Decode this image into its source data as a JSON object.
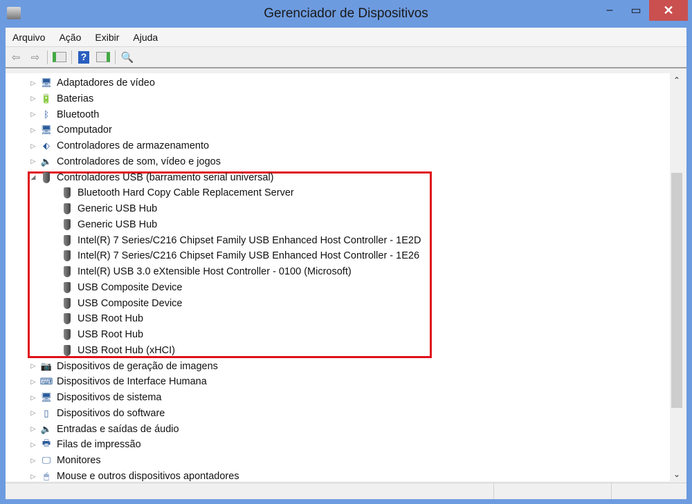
{
  "window": {
    "title": "Gerenciador de Dispositivos",
    "minimize": "–",
    "maximize": "▭",
    "close": "✕"
  },
  "menu": [
    "Arquivo",
    "Ação",
    "Exibir",
    "Ajuda"
  ],
  "toolbar": {
    "back": "⇦",
    "forward": "⇨",
    "help": "?"
  },
  "tree": [
    {
      "label": "Adaptadores de vídeo",
      "icon": "display-adapter-icon",
      "glyph": "🖥",
      "level": 0,
      "exp": "▷"
    },
    {
      "label": "Baterias",
      "icon": "battery-icon",
      "glyph": "🔋",
      "level": 0,
      "exp": "▷"
    },
    {
      "label": "Bluetooth",
      "icon": "bluetooth-icon",
      "glyph": "ᛒ",
      "level": 0,
      "exp": "▷"
    },
    {
      "label": "Computador",
      "icon": "computer-icon",
      "glyph": "🖥",
      "level": 0,
      "exp": "▷"
    },
    {
      "label": "Controladores de armazenamento",
      "icon": "storage-controller-icon",
      "glyph": "⬖",
      "level": 0,
      "exp": "▷"
    },
    {
      "label": "Controladores de som, vídeo e jogos",
      "icon": "speaker-icon",
      "glyph": "🔈",
      "level": 0,
      "exp": "▷"
    },
    {
      "label": "Controladores USB (barramento serial universal)",
      "icon": "usb-icon",
      "level": 0,
      "exp": "◢"
    },
    {
      "label": "Bluetooth Hard Copy Cable Replacement Server",
      "icon": "usb-icon",
      "level": 1
    },
    {
      "label": "Generic USB Hub",
      "icon": "usb-icon",
      "level": 1
    },
    {
      "label": "Generic USB Hub",
      "icon": "usb-icon",
      "level": 1
    },
    {
      "label": "Intel(R) 7 Series/C216 Chipset Family USB Enhanced Host Controller - 1E2D",
      "icon": "usb-icon",
      "level": 1
    },
    {
      "label": "Intel(R) 7 Series/C216 Chipset Family USB Enhanced Host Controller - 1E26",
      "icon": "usb-icon",
      "level": 1
    },
    {
      "label": "Intel(R) USB 3.0 eXtensible Host Controller - 0100 (Microsoft)",
      "icon": "usb-icon",
      "level": 1
    },
    {
      "label": "USB Composite Device",
      "icon": "usb-icon",
      "level": 1
    },
    {
      "label": "USB Composite Device",
      "icon": "usb-icon",
      "level": 1
    },
    {
      "label": "USB Root Hub",
      "icon": "usb-icon",
      "level": 1
    },
    {
      "label": "USB Root Hub",
      "icon": "usb-icon",
      "level": 1
    },
    {
      "label": "USB Root Hub (xHCI)",
      "icon": "usb-icon",
      "level": 1
    },
    {
      "label": "Dispositivos de geração de imagens",
      "icon": "imaging-device-icon",
      "glyph": "📷",
      "level": 0,
      "exp": "▷"
    },
    {
      "label": "Dispositivos de Interface Humana",
      "icon": "hid-icon",
      "glyph": "⌨",
      "level": 0,
      "exp": "▷"
    },
    {
      "label": "Dispositivos de sistema",
      "icon": "system-device-icon",
      "glyph": "🖥",
      "level": 0,
      "exp": "▷"
    },
    {
      "label": "Dispositivos do software",
      "icon": "software-device-icon",
      "glyph": "▯",
      "level": 0,
      "exp": "▷"
    },
    {
      "label": "Entradas e saídas de áudio",
      "icon": "audio-icon",
      "glyph": "🔈",
      "level": 0,
      "exp": "▷"
    },
    {
      "label": "Filas de impressão",
      "icon": "printer-icon",
      "glyph": "🖶",
      "level": 0,
      "exp": "▷"
    },
    {
      "label": "Monitores",
      "icon": "monitor-icon",
      "glyph": "🖵",
      "level": 0,
      "exp": "▷"
    },
    {
      "label": "Mouse e outros dispositivos apontadores",
      "icon": "mouse-icon",
      "glyph": "🖱",
      "level": 0,
      "exp": "▷"
    }
  ]
}
